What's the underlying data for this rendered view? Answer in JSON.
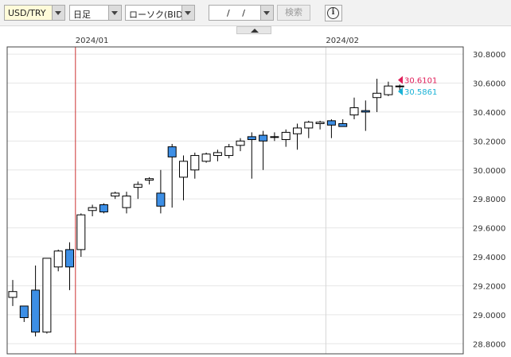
{
  "toolbar": {
    "pair": "USD/TRY",
    "period": "日足",
    "chart_kind": "ローソク(BID)",
    "date_value": "/ /",
    "search_label": "検索",
    "info_glyph": "i"
  },
  "chart_data": {
    "type": "candlestick",
    "x_ticks": [
      "2024/01",
      "2024/02"
    ],
    "y_ticks": [
      "30.8000",
      "30.6000",
      "30.4000",
      "30.2000",
      "30.0000",
      "29.8000",
      "29.6000",
      "29.4000",
      "29.2000",
      "29.0000",
      "28.8000"
    ],
    "ylim": [
      28.73,
      30.85
    ],
    "grid": true,
    "up_color": "#ffffff",
    "down_color": "#3d8fe6",
    "divider_color": "#cc3333",
    "candles": [
      {
        "o": 29.12,
        "h": 29.24,
        "l": 29.06,
        "c": 29.16,
        "dir": "up"
      },
      {
        "o": 29.06,
        "h": 29.06,
        "l": 28.95,
        "c": 28.98,
        "dir": "down"
      },
      {
        "o": 29.17,
        "h": 29.34,
        "l": 28.85,
        "c": 28.88,
        "dir": "down"
      },
      {
        "o": 28.88,
        "h": 29.39,
        "l": 28.87,
        "c": 29.39,
        "dir": "up"
      },
      {
        "o": 29.33,
        "h": 29.45,
        "l": 29.3,
        "c": 29.44,
        "dir": "up"
      },
      {
        "o": 29.45,
        "h": 29.5,
        "l": 29.17,
        "c": 29.33,
        "dir": "down"
      },
      {
        "o": 29.45,
        "h": 29.7,
        "l": 29.4,
        "c": 29.69,
        "dir": "up"
      },
      {
        "o": 29.72,
        "h": 29.76,
        "l": 29.68,
        "c": 29.74,
        "dir": "up"
      },
      {
        "o": 29.76,
        "h": 29.77,
        "l": 29.7,
        "c": 29.71,
        "dir": "down"
      },
      {
        "o": 29.82,
        "h": 29.85,
        "l": 29.8,
        "c": 29.84,
        "dir": "up"
      },
      {
        "o": 29.74,
        "h": 29.85,
        "l": 29.7,
        "c": 29.82,
        "dir": "up"
      },
      {
        "o": 29.88,
        "h": 29.92,
        "l": 29.8,
        "c": 29.9,
        "dir": "up"
      },
      {
        "o": 29.93,
        "h": 29.95,
        "l": 29.9,
        "c": 29.94,
        "dir": "up"
      },
      {
        "o": 29.84,
        "h": 30.0,
        "l": 29.7,
        "c": 29.75,
        "dir": "down"
      },
      {
        "o": 30.16,
        "h": 30.18,
        "l": 29.74,
        "c": 30.09,
        "dir": "down"
      },
      {
        "o": 29.95,
        "h": 30.1,
        "l": 29.79,
        "c": 30.06,
        "dir": "up"
      },
      {
        "o": 30.0,
        "h": 30.12,
        "l": 29.94,
        "c": 30.1,
        "dir": "up"
      },
      {
        "o": 30.06,
        "h": 30.12,
        "l": 30.05,
        "c": 30.11,
        "dir": "up"
      },
      {
        "o": 30.1,
        "h": 30.14,
        "l": 30.06,
        "c": 30.12,
        "dir": "up"
      },
      {
        "o": 30.1,
        "h": 30.18,
        "l": 30.08,
        "c": 30.16,
        "dir": "up"
      },
      {
        "o": 30.17,
        "h": 30.22,
        "l": 30.13,
        "c": 30.2,
        "dir": "up"
      },
      {
        "o": 30.23,
        "h": 30.26,
        "l": 29.94,
        "c": 30.21,
        "dir": "down"
      },
      {
        "o": 30.24,
        "h": 30.27,
        "l": 30.0,
        "c": 30.2,
        "dir": "down"
      },
      {
        "o": 30.23,
        "h": 30.26,
        "l": 30.2,
        "c": 30.23,
        "dir": "up"
      },
      {
        "o": 30.21,
        "h": 30.28,
        "l": 30.16,
        "c": 30.26,
        "dir": "up"
      },
      {
        "o": 30.25,
        "h": 30.32,
        "l": 30.14,
        "c": 30.29,
        "dir": "up"
      },
      {
        "o": 30.29,
        "h": 30.34,
        "l": 30.22,
        "c": 30.33,
        "dir": "up"
      },
      {
        "o": 30.32,
        "h": 30.34,
        "l": 30.28,
        "c": 30.33,
        "dir": "up"
      },
      {
        "o": 30.34,
        "h": 30.35,
        "l": 30.22,
        "c": 30.31,
        "dir": "down"
      },
      {
        "o": 30.32,
        "h": 30.35,
        "l": 30.3,
        "c": 30.3,
        "dir": "down"
      },
      {
        "o": 30.38,
        "h": 30.5,
        "l": 30.35,
        "c": 30.43,
        "dir": "up"
      },
      {
        "o": 30.41,
        "h": 30.48,
        "l": 30.27,
        "c": 30.4,
        "dir": "down"
      },
      {
        "o": 30.5,
        "h": 30.63,
        "l": 30.4,
        "c": 30.53,
        "dir": "up"
      },
      {
        "o": 30.52,
        "h": 30.61,
        "l": 30.51,
        "c": 30.58,
        "dir": "up"
      },
      {
        "o": 30.58,
        "h": 30.59,
        "l": 30.55,
        "c": 30.58,
        "dir": "up"
      }
    ],
    "price_labels": [
      {
        "text": "30.6101",
        "value": 30.6101,
        "color": "#e0205a"
      },
      {
        "text": "30.5861",
        "value": 30.5861,
        "color": "#1ab2d6"
      }
    ]
  }
}
